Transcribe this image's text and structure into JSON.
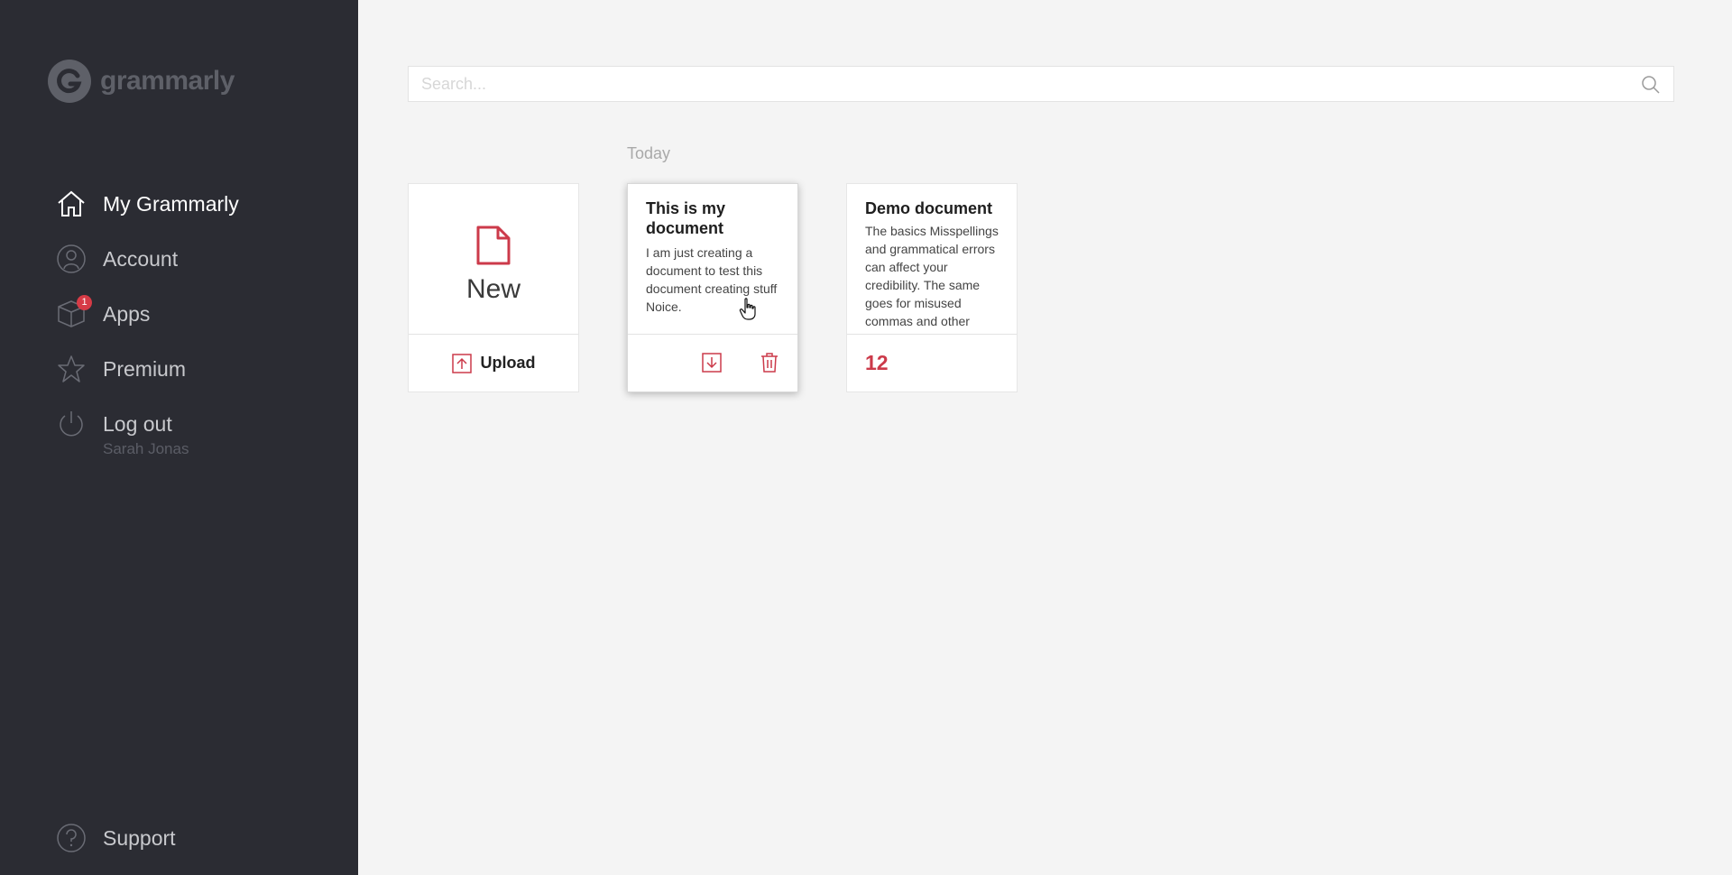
{
  "sidebar": {
    "logo_text": "grammarly",
    "items": [
      {
        "label": "My Grammarly",
        "icon": "home-icon"
      },
      {
        "label": "Account",
        "icon": "user-icon"
      },
      {
        "label": "Apps",
        "icon": "box-icon",
        "badge": "1"
      },
      {
        "label": "Premium",
        "icon": "star-icon"
      },
      {
        "label": "Log out",
        "icon": "power-icon"
      }
    ],
    "user_name": "Sarah Jonas",
    "support_label": "Support"
  },
  "search": {
    "placeholder": "Search..."
  },
  "main": {
    "section_label": "Today",
    "new_card": {
      "label": "New",
      "upload_label": "Upload"
    },
    "documents": [
      {
        "title": "This is my document",
        "excerpt": "I am just creating a document to test this document creating stuff Noice."
      },
      {
        "title": "Demo document",
        "excerpt": "The basics Misspellings and grammatical errors can affect your credibility. The same goes for misused commas and other",
        "issue_count": "12"
      }
    ]
  },
  "colors": {
    "accent": "#cc3a4a",
    "sidebar_bg": "#2b2c33",
    "page_bg": "#f4f4f4"
  }
}
